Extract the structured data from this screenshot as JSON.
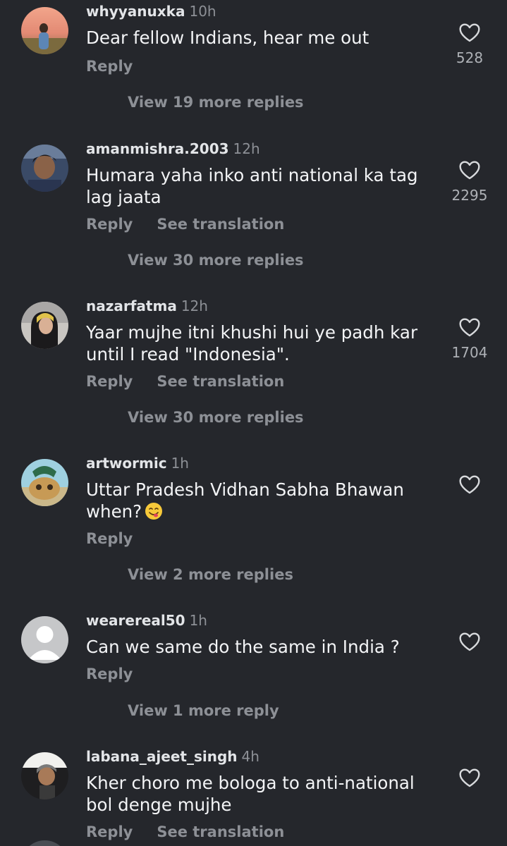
{
  "comments": [
    {
      "username": "whyyanuxka",
      "time": "10h",
      "text_lines": [
        "Dear fellow Indians, hear me out"
      ],
      "reply_label": "Reply",
      "translation_label": "",
      "likes": "528",
      "view_more_label": "View 19 more replies"
    },
    {
      "username": "amanmishra.2003",
      "time": "12h",
      "text_lines": [
        "Humara yaha inko anti national ka tag",
        "lag jaata"
      ],
      "reply_label": "Reply",
      "translation_label": "See translation",
      "likes": "2295",
      "view_more_label": "View 30 more replies"
    },
    {
      "username": "nazarfatma",
      "time": "12h",
      "text_lines": [
        "Yaar mujhe itni khushi hui ye padh kar",
        "until I read \"Indonesia\"."
      ],
      "reply_label": "Reply",
      "translation_label": "See translation",
      "likes": "1704",
      "view_more_label": "View 30 more replies"
    },
    {
      "username": "artwormic",
      "time": "1h",
      "text_lines": [
        "Uttar Pradesh Vidhan Sabha Bhawan",
        "when?"
      ],
      "reply_label": "Reply",
      "translation_label": "",
      "likes": "",
      "view_more_label": "View 2 more replies"
    },
    {
      "username": "wearereal50",
      "time": "1h",
      "text_lines": [
        "Can we same do the same in India ?"
      ],
      "reply_label": "Reply",
      "translation_label": "",
      "likes": "",
      "view_more_label": "View 1 more reply"
    },
    {
      "username": "labana_ajeet_singh",
      "time": "4h",
      "text_lines": [
        "Kher choro me bologa to anti-national",
        "bol denge mujhe"
      ],
      "reply_label": "Reply",
      "translation_label": "See translation",
      "likes": "",
      "view_more_label": ""
    }
  ],
  "icons": {
    "like": "heart-outline-icon",
    "emoji": "face-savoring-food-emoji"
  },
  "colors": {
    "background": "#25272c",
    "username": "#e3e5e8",
    "comment_text": "#f3f4f6",
    "secondary_text": "#8d9096"
  }
}
